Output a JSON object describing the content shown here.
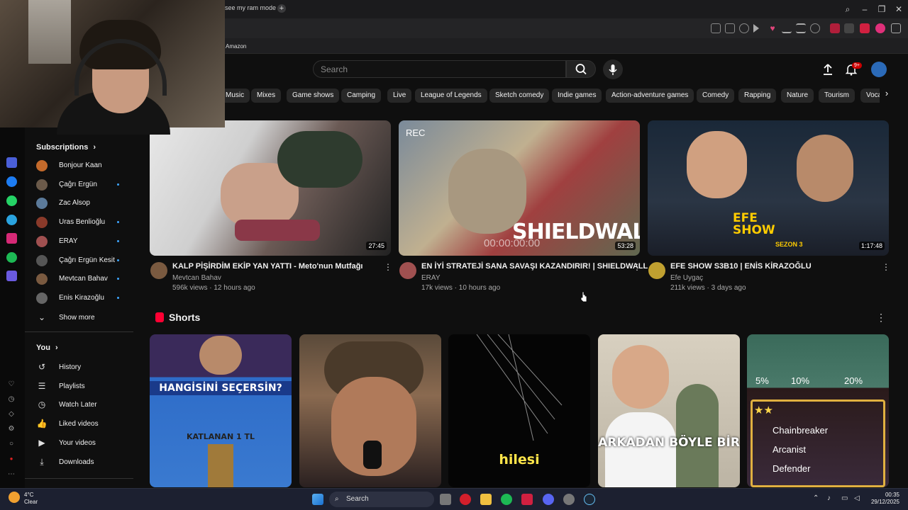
{
  "browser": {
    "tab_title": "see my ram mode",
    "new_tab": "+",
    "bookmark": "Amazon",
    "window_controls": {
      "search": "⌕",
      "minimize": "–",
      "restore": "❐",
      "close": "✕"
    }
  },
  "header": {
    "search_placeholder": "Search",
    "notification_badge": "9+"
  },
  "chips": [
    "Music",
    "Mixes",
    "Game shows",
    "Camping",
    "Live",
    "League of Legends",
    "Sketch comedy",
    "Indie games",
    "Action-adventure games",
    "Comedy",
    "Rapping",
    "Nature",
    "Tourism",
    "Voca"
  ],
  "chip_next": "›",
  "sidebar": {
    "subscriptions_title": "Subscriptions",
    "subscriptions_arrow": "›",
    "subscriptions": [
      {
        "name": "Bonjour Kaan",
        "new": false,
        "color": "#c46a2b"
      },
      {
        "name": "Çağrı Ergün",
        "new": true,
        "color": "#6b5a4a"
      },
      {
        "name": "Zac Alsop",
        "new": false,
        "color": "#5b7a9a"
      },
      {
        "name": "Uras Benlioğlu",
        "new": true,
        "color": "#8a3a2a"
      },
      {
        "name": "ERAY",
        "new": true,
        "color": "#a05050"
      },
      {
        "name": "Çağrı Ergün Kesit",
        "new": true,
        "color": "#555"
      },
      {
        "name": "Mevtcan Bahav",
        "new": true,
        "color": "#7a5a40"
      },
      {
        "name": "Enis Kirazoğlu",
        "new": true,
        "color": "#666"
      }
    ],
    "show_more": "Show more",
    "you_title": "You",
    "you_arrow": "›",
    "you_items": [
      {
        "label": "History",
        "icon": "↺"
      },
      {
        "label": "Playlists",
        "icon": "☰"
      },
      {
        "label": "Watch Later",
        "icon": "◷"
      },
      {
        "label": "Liked videos",
        "icon": "👍"
      },
      {
        "label": "Your videos",
        "icon": "▶"
      },
      {
        "label": "Downloads",
        "icon": "⤓"
      }
    ]
  },
  "videos": [
    {
      "title": "KALP PİŞİRDİM EKİP YAN YATTI - Meto'nun Mutfağı",
      "channel": "Mevtcan Bahav",
      "views": "596k views",
      "age": "12 hours ago",
      "duration": "27:45",
      "menu": "⋮"
    },
    {
      "title": "EN İYİ STRATEJİ SANA SAVAŞI KAZANDIRIR! | SHIELDWALL",
      "channel": "ERAY",
      "views": "17k views",
      "age": "10 hours ago",
      "duration": "53:28",
      "menu": "⋮",
      "overlay_rec": "REC",
      "overlay_title": "SHIELDWALL",
      "overlay_time": "00:00:00:00"
    },
    {
      "title": "EFE SHOW S3B10 | ENİS KİRAZOĞLU",
      "channel": "Efe Uygaç",
      "views": "211k views",
      "age": "3 days ago",
      "duration": "1:17:48",
      "menu": "⋮",
      "overlay_title": "EFE SHOW",
      "overlay_sub": "SEZON 3"
    }
  ],
  "shorts": {
    "title": "Shorts",
    "menu": "⋮",
    "items": [
      {
        "caption_top": "HANGİSİNİ SEÇERSİN?",
        "caption": "KATLANAN 1 TL"
      },
      {
        "caption": ""
      },
      {
        "caption": "hilesi"
      },
      {
        "caption": "ARKADAN BÖYLE BİR"
      },
      {
        "pct1": "5%",
        "pct2": "10%",
        "pct3": "20%",
        "traits": [
          "Chainbreaker",
          "Arcanist",
          "Defender"
        ]
      }
    ]
  },
  "taskbar": {
    "temperature": "4°C",
    "weather": "Clear",
    "search": "Search",
    "time": "00:35",
    "date": "29/12/2025"
  }
}
